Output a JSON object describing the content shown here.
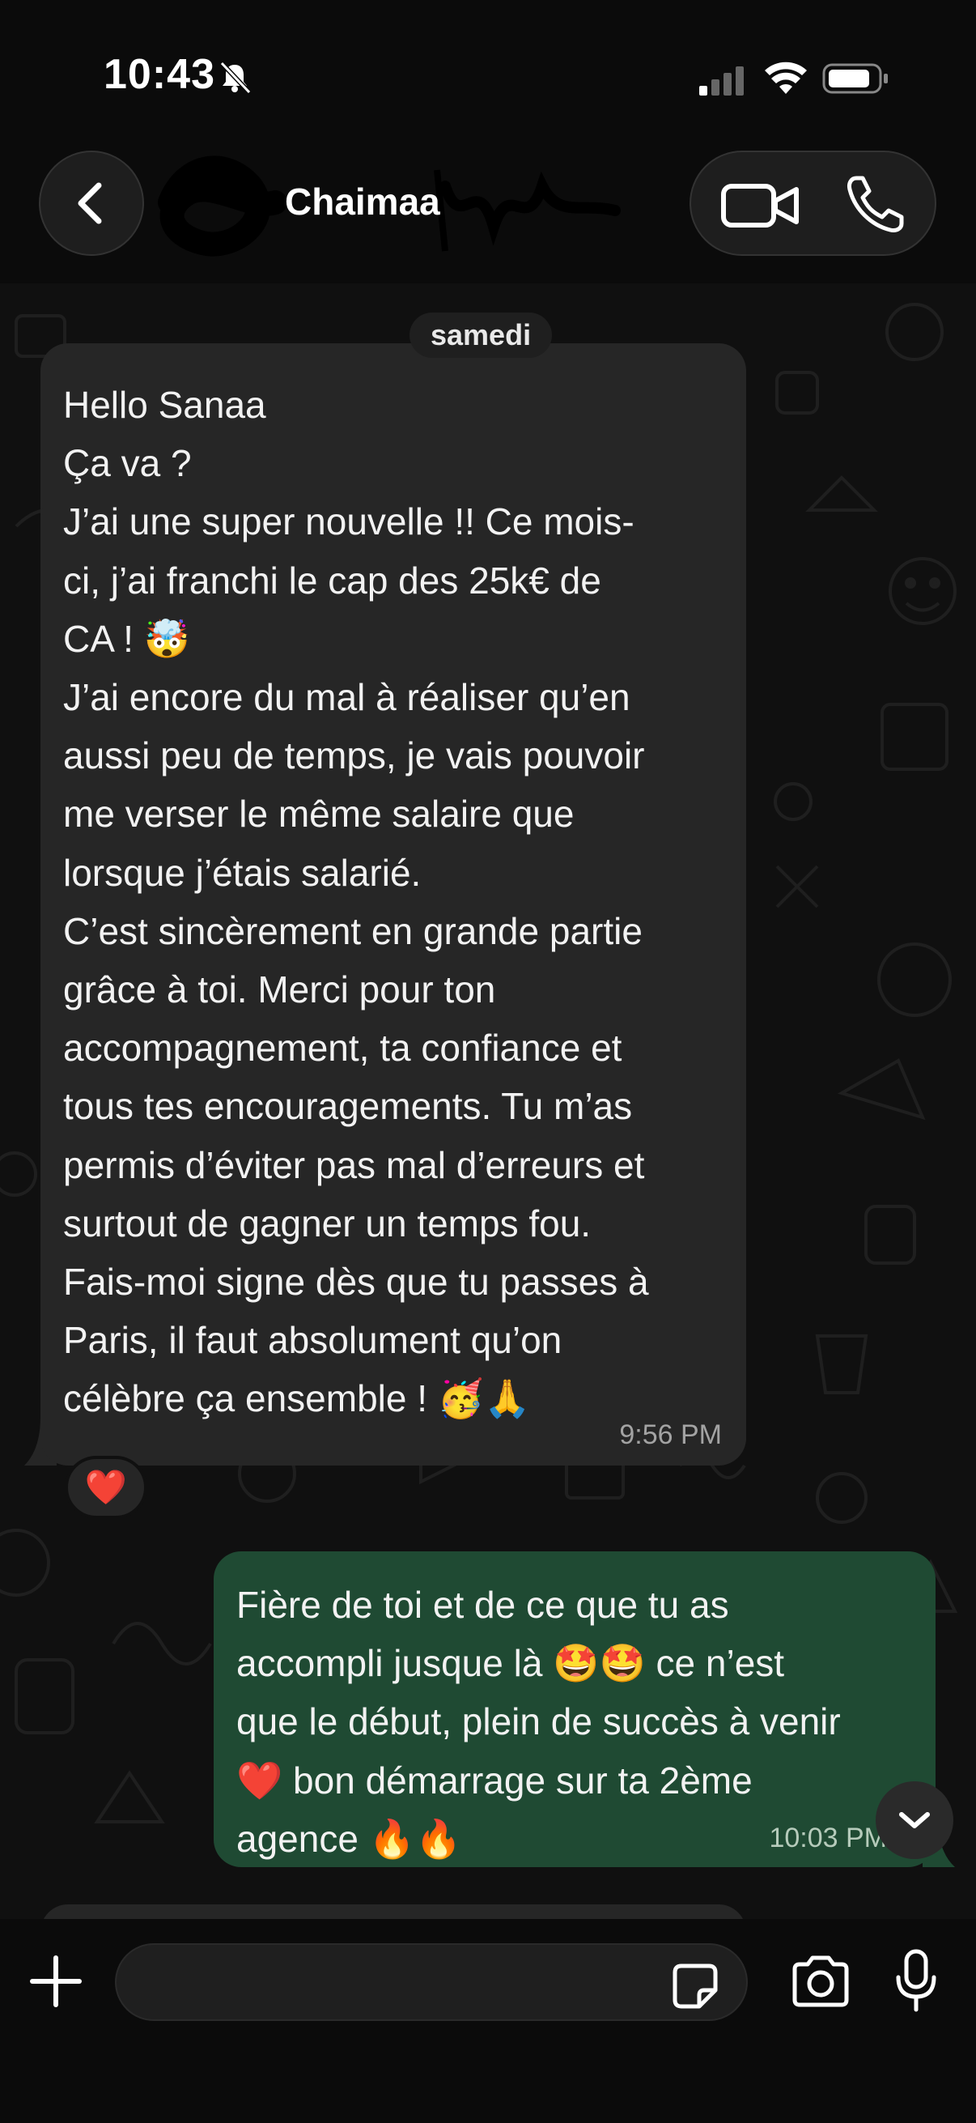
{
  "status_bar": {
    "time": "10:43"
  },
  "header": {
    "contact_name": "Chaimaa"
  },
  "chat": {
    "date_chip": "samedi",
    "incoming": {
      "lines": [
        "Hello Sanaa",
        "Ça va ?",
        "J’ai une super nouvelle !!  Ce mois-",
        "ci, j’ai franchi le cap des 25k€ de",
        "CA ! 🤯",
        "J’ai encore du mal à réaliser qu’en",
        "aussi peu de temps, je vais pouvoir",
        "me verser le même salaire que",
        "lorsque j’étais salarié.",
        "C’est sincèrement en grande partie",
        "grâce à toi. Merci pour ton",
        "accompagnement, ta confiance et",
        "tous tes encouragements. Tu m’as",
        "permis d’éviter pas mal d’erreurs et",
        "surtout de gagner un temps fou.",
        "Fais-moi signe dès que tu passes à",
        "Paris, il faut absolument qu’on",
        "célèbre ça ensemble ! 🥳🙏"
      ],
      "time": "9:56 PM",
      "reaction": "❤️"
    },
    "outgoing": {
      "lines": [
        "Fière de toi et de ce que tu as",
        "accompli jusque là 🤩🤩 ce n’est",
        "que le début, plein de succès à venir",
        "❤️ bon démarrage sur ta 2ème",
        "agence 🔥🔥"
      ],
      "time": "10:03 PM"
    }
  },
  "composer": {
    "placeholder": ""
  },
  "icons": {
    "back": "chevron-left-icon",
    "video": "video-camera-icon",
    "phone": "phone-icon",
    "plus": "plus-icon",
    "sticker": "sticker-icon",
    "camera": "camera-icon",
    "mic": "microphone-icon",
    "scroll": "chevron-down-icon"
  },
  "colors": {
    "background": "#0b0b0b",
    "incoming_bubble": "#262626",
    "outgoing_bubble": "#1f4a33"
  }
}
